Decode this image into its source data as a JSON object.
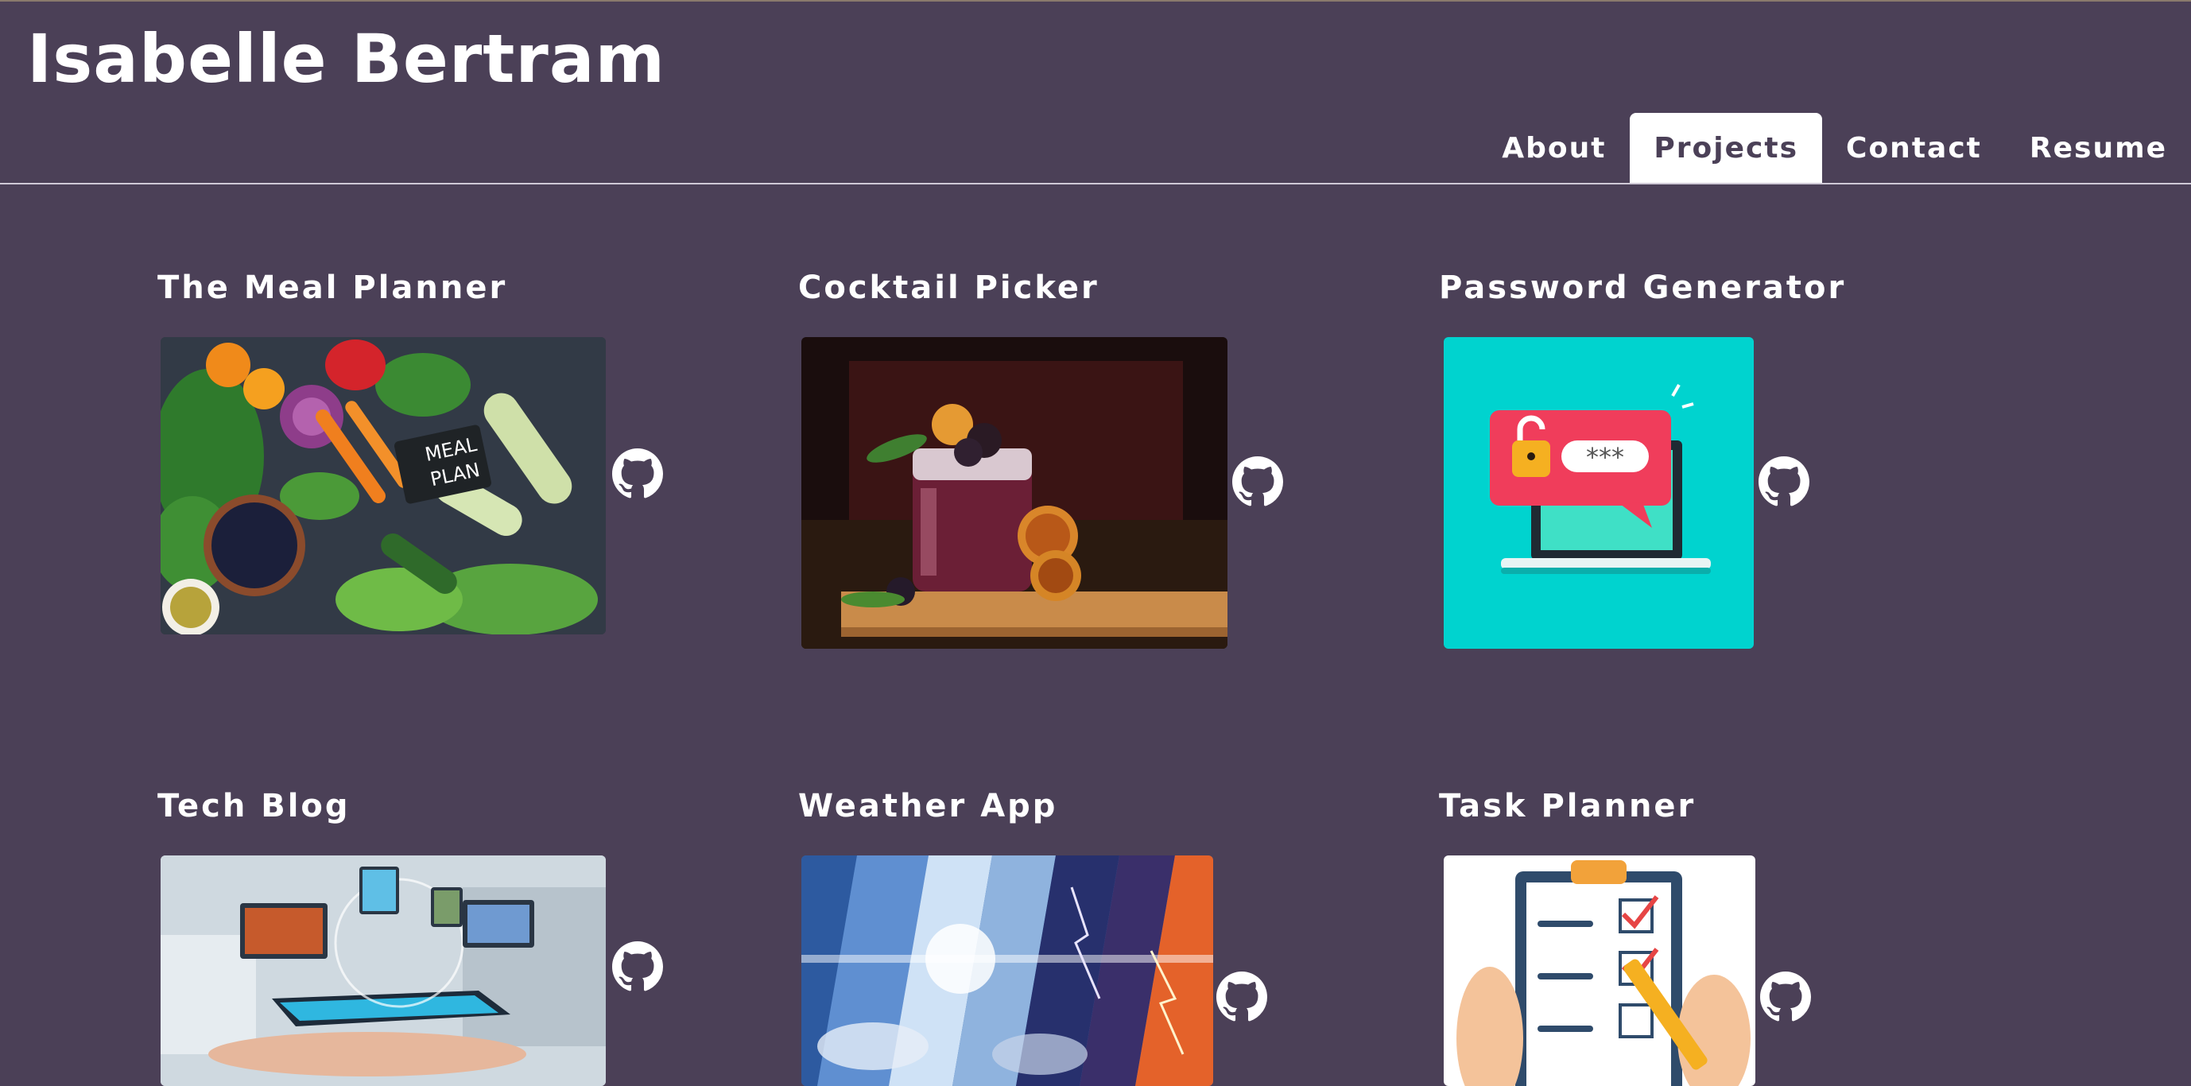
{
  "site": {
    "title": "Isabelle Bertram"
  },
  "nav": {
    "items": [
      "About",
      "Projects",
      "Contact",
      "Resume"
    ],
    "active": "Projects"
  },
  "projects": [
    {
      "title": "The Meal Planner",
      "image_label_1": "MEAL",
      "image_label_2": "PLAN",
      "link_icon": "github-icon"
    },
    {
      "title": "Cocktail Picker",
      "link_icon": "github-icon"
    },
    {
      "title": "Password Generator",
      "image_label": "***",
      "link_icon": "github-icon"
    },
    {
      "title": "Tech Blog",
      "link_icon": "github-icon"
    },
    {
      "title": "Weather App",
      "link_icon": "github-icon"
    },
    {
      "title": "Task Planner",
      "link_icon": "github-icon"
    }
  ],
  "colors": {
    "background": "#4b4057",
    "text": "#ffffff",
    "active_tab_bg": "#ffffff",
    "active_tab_text": "#4b4057"
  }
}
